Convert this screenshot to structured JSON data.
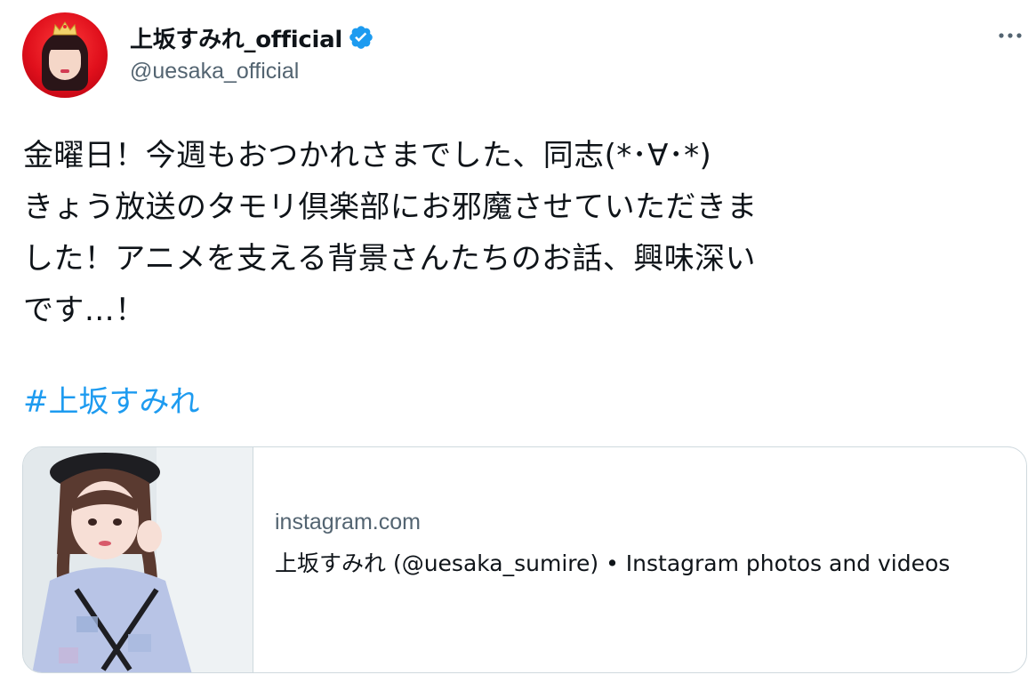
{
  "author": {
    "display_name": "上坂すみれ_official",
    "handle": "@uesaka_official",
    "verified_icon": "verified-badge-icon",
    "avatar_icon": "profile-photo"
  },
  "menu_icon": "more-options-icon",
  "tweet": {
    "lines": [
      "金曜日！今週もおつかれさまでした、同志(*･∀･*)",
      "きょう放送のタモリ倶楽部にお邪魔させていただきま",
      "した！アニメを支える背景さんたちのお話、興味深い",
      "です…！"
    ],
    "hashtag": "#上坂すみれ"
  },
  "link_card": {
    "domain": "instagram.com",
    "title": "上坂すみれ (@uesaka_sumire) • Instagram photos and videos",
    "thumbnail": "instagram-profile-photo"
  },
  "colors": {
    "link_blue": "#1d9bf0",
    "secondary_text": "#536471",
    "primary_text": "#0f1419",
    "border": "#cfd9de"
  }
}
